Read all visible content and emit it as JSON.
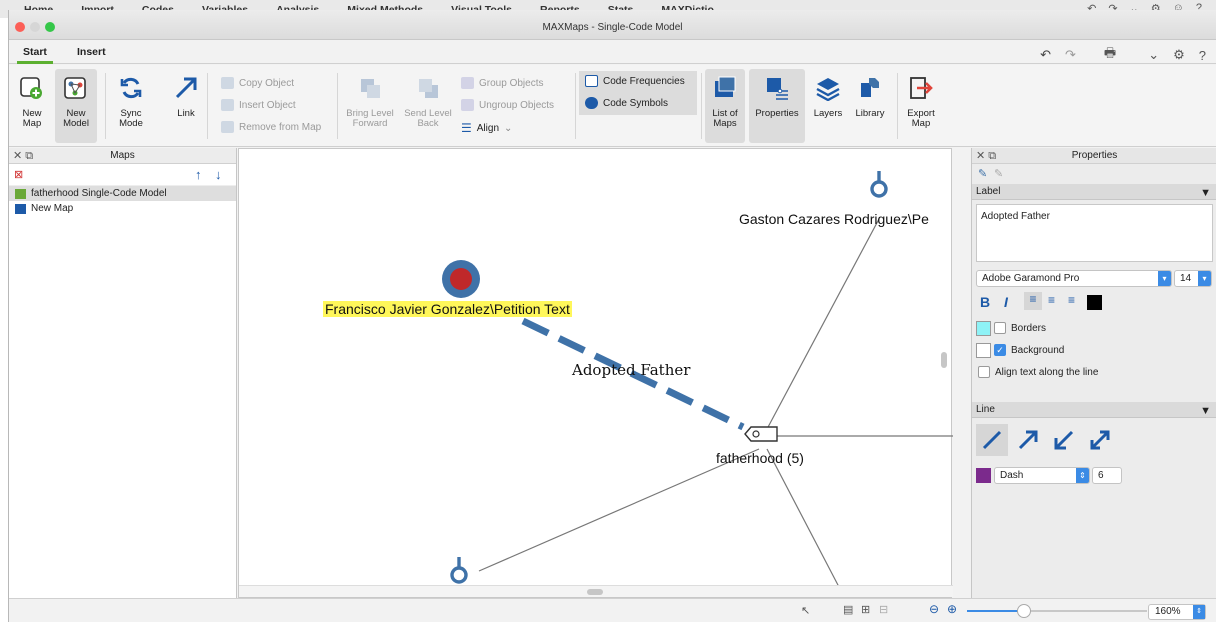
{
  "bg_app": {
    "menu": [
      "Home",
      "Import",
      "Codes",
      "Variables",
      "Analysis",
      "Mixed Methods",
      "Visual Tools",
      "Reports",
      "Stats",
      "MAXDictio"
    ]
  },
  "window": {
    "title": "MAXMaps - Single-Code Model"
  },
  "tabs": [
    "Start",
    "Insert"
  ],
  "ribbon": {
    "new_map": [
      "New",
      "Map"
    ],
    "new_model": [
      "New",
      "Model"
    ],
    "sync_mode": [
      "Sync",
      "Mode"
    ],
    "link": "Link",
    "copy_object": "Copy Object",
    "insert_object": "Insert Object",
    "remove_from_map": "Remove from Map",
    "bring_level": [
      "Bring Level",
      "Forward"
    ],
    "send_level": [
      "Send Level",
      "Back"
    ],
    "group_objects": "Group Objects",
    "ungroup_objects": "Ungroup Objects",
    "align": "Align",
    "code_frequencies": "Code Frequencies",
    "code_symbols": "Code Symbols",
    "list_of_maps": [
      "List of",
      "Maps"
    ],
    "properties": "Properties",
    "layers": "Layers",
    "library": "Library",
    "export_map": [
      "Export",
      "Map"
    ]
  },
  "maps_panel": {
    "title": "Maps",
    "items": [
      "fatherhood Single-Code Model",
      "New Map"
    ]
  },
  "canvas": {
    "node_top": "Gaston Cazares Rodriguez\\Pe",
    "node_left": "Francisco Javier Gonzalez\\Petition Text",
    "link_label": "Adopted Father",
    "center_code": "fatherhood (5)"
  },
  "properties_panel": {
    "title": "Properties",
    "label_section": "Label",
    "label_text": "Adopted Father",
    "font": "Adobe Garamond Pro",
    "font_size": "14",
    "bold": "B",
    "italic": "I",
    "borders": "Borders",
    "background": "Background",
    "align_text": "Align text along the line",
    "line_section": "Line",
    "line_style": "Dash",
    "line_width": "6"
  },
  "statusbar": {
    "zoom": "160%"
  },
  "colors": {
    "accent_green": "#5cb030",
    "map_blue": "#3f72a8",
    "node_red": "#c0282a",
    "highlight_yellow": "#fff75a",
    "line_color_swatch": "#7b2a8c",
    "border_swatch": "#8ef2f6",
    "ui_blue": "#3b8be5"
  }
}
